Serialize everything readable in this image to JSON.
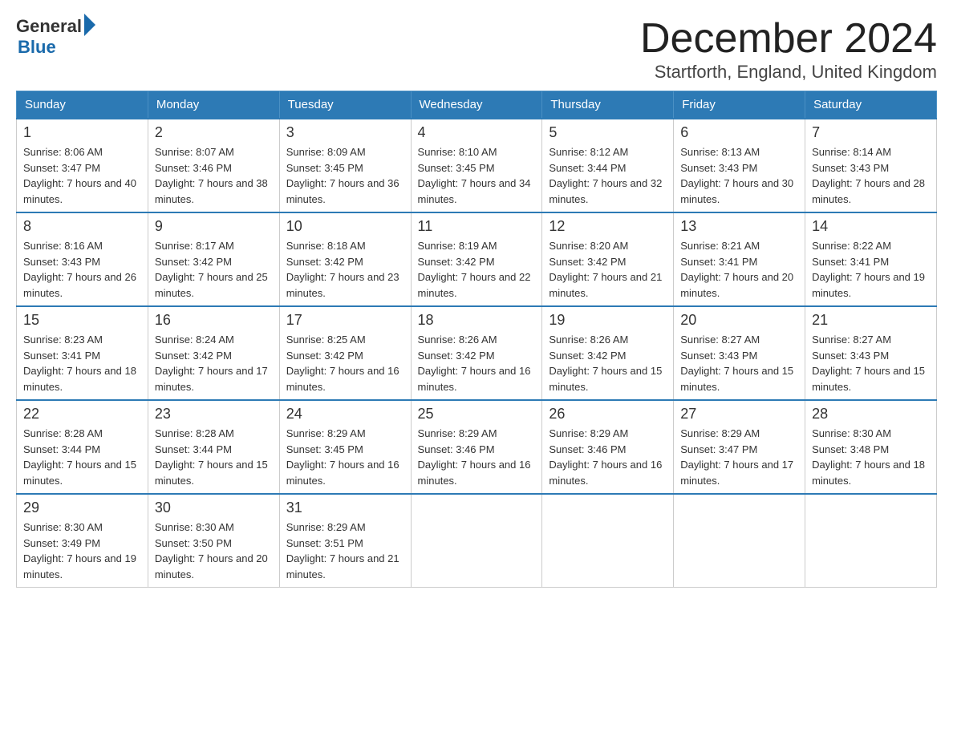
{
  "logo": {
    "general": "General",
    "blue": "Blue"
  },
  "title": "December 2024",
  "subtitle": "Startforth, England, United Kingdom",
  "weekdays": [
    "Sunday",
    "Monday",
    "Tuesday",
    "Wednesday",
    "Thursday",
    "Friday",
    "Saturday"
  ],
  "weeks": [
    [
      {
        "day": "1",
        "sunrise": "8:06 AM",
        "sunset": "3:47 PM",
        "daylight": "7 hours and 40 minutes."
      },
      {
        "day": "2",
        "sunrise": "8:07 AM",
        "sunset": "3:46 PM",
        "daylight": "7 hours and 38 minutes."
      },
      {
        "day": "3",
        "sunrise": "8:09 AM",
        "sunset": "3:45 PM",
        "daylight": "7 hours and 36 minutes."
      },
      {
        "day": "4",
        "sunrise": "8:10 AM",
        "sunset": "3:45 PM",
        "daylight": "7 hours and 34 minutes."
      },
      {
        "day": "5",
        "sunrise": "8:12 AM",
        "sunset": "3:44 PM",
        "daylight": "7 hours and 32 minutes."
      },
      {
        "day": "6",
        "sunrise": "8:13 AM",
        "sunset": "3:43 PM",
        "daylight": "7 hours and 30 minutes."
      },
      {
        "day": "7",
        "sunrise": "8:14 AM",
        "sunset": "3:43 PM",
        "daylight": "7 hours and 28 minutes."
      }
    ],
    [
      {
        "day": "8",
        "sunrise": "8:16 AM",
        "sunset": "3:43 PM",
        "daylight": "7 hours and 26 minutes."
      },
      {
        "day": "9",
        "sunrise": "8:17 AM",
        "sunset": "3:42 PM",
        "daylight": "7 hours and 25 minutes."
      },
      {
        "day": "10",
        "sunrise": "8:18 AM",
        "sunset": "3:42 PM",
        "daylight": "7 hours and 23 minutes."
      },
      {
        "day": "11",
        "sunrise": "8:19 AM",
        "sunset": "3:42 PM",
        "daylight": "7 hours and 22 minutes."
      },
      {
        "day": "12",
        "sunrise": "8:20 AM",
        "sunset": "3:42 PM",
        "daylight": "7 hours and 21 minutes."
      },
      {
        "day": "13",
        "sunrise": "8:21 AM",
        "sunset": "3:41 PM",
        "daylight": "7 hours and 20 minutes."
      },
      {
        "day": "14",
        "sunrise": "8:22 AM",
        "sunset": "3:41 PM",
        "daylight": "7 hours and 19 minutes."
      }
    ],
    [
      {
        "day": "15",
        "sunrise": "8:23 AM",
        "sunset": "3:41 PM",
        "daylight": "7 hours and 18 minutes."
      },
      {
        "day": "16",
        "sunrise": "8:24 AM",
        "sunset": "3:42 PM",
        "daylight": "7 hours and 17 minutes."
      },
      {
        "day": "17",
        "sunrise": "8:25 AM",
        "sunset": "3:42 PM",
        "daylight": "7 hours and 16 minutes."
      },
      {
        "day": "18",
        "sunrise": "8:26 AM",
        "sunset": "3:42 PM",
        "daylight": "7 hours and 16 minutes."
      },
      {
        "day": "19",
        "sunrise": "8:26 AM",
        "sunset": "3:42 PM",
        "daylight": "7 hours and 15 minutes."
      },
      {
        "day": "20",
        "sunrise": "8:27 AM",
        "sunset": "3:43 PM",
        "daylight": "7 hours and 15 minutes."
      },
      {
        "day": "21",
        "sunrise": "8:27 AM",
        "sunset": "3:43 PM",
        "daylight": "7 hours and 15 minutes."
      }
    ],
    [
      {
        "day": "22",
        "sunrise": "8:28 AM",
        "sunset": "3:44 PM",
        "daylight": "7 hours and 15 minutes."
      },
      {
        "day": "23",
        "sunrise": "8:28 AM",
        "sunset": "3:44 PM",
        "daylight": "7 hours and 15 minutes."
      },
      {
        "day": "24",
        "sunrise": "8:29 AM",
        "sunset": "3:45 PM",
        "daylight": "7 hours and 16 minutes."
      },
      {
        "day": "25",
        "sunrise": "8:29 AM",
        "sunset": "3:46 PM",
        "daylight": "7 hours and 16 minutes."
      },
      {
        "day": "26",
        "sunrise": "8:29 AM",
        "sunset": "3:46 PM",
        "daylight": "7 hours and 16 minutes."
      },
      {
        "day": "27",
        "sunrise": "8:29 AM",
        "sunset": "3:47 PM",
        "daylight": "7 hours and 17 minutes."
      },
      {
        "day": "28",
        "sunrise": "8:30 AM",
        "sunset": "3:48 PM",
        "daylight": "7 hours and 18 minutes."
      }
    ],
    [
      {
        "day": "29",
        "sunrise": "8:30 AM",
        "sunset": "3:49 PM",
        "daylight": "7 hours and 19 minutes."
      },
      {
        "day": "30",
        "sunrise": "8:30 AM",
        "sunset": "3:50 PM",
        "daylight": "7 hours and 20 minutes."
      },
      {
        "day": "31",
        "sunrise": "8:29 AM",
        "sunset": "3:51 PM",
        "daylight": "7 hours and 21 minutes."
      },
      null,
      null,
      null,
      null
    ]
  ]
}
